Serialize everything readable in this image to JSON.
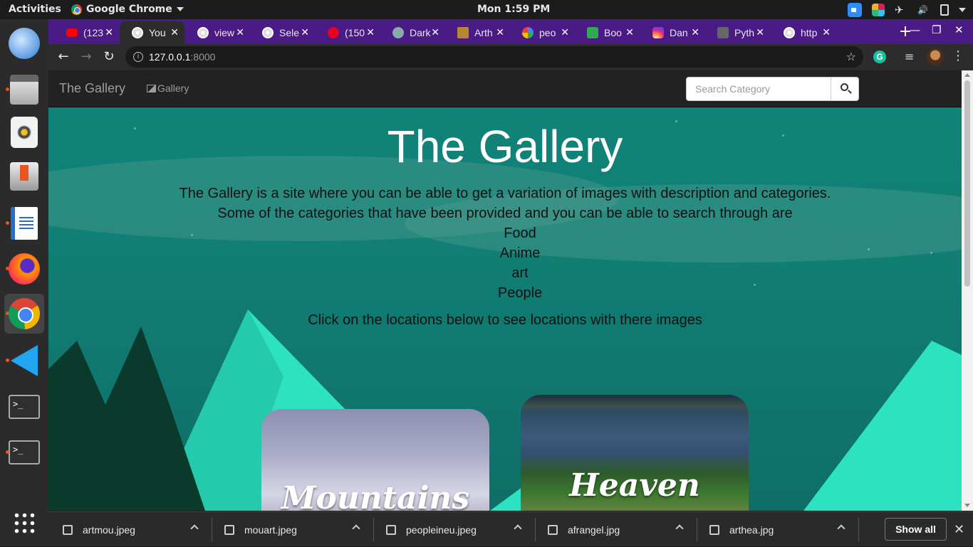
{
  "topbar": {
    "activities": "Activities",
    "app_name": "Google Chrome",
    "clock": "Mon  1:59 PM"
  },
  "dock": {
    "items": [
      "thunderbird-icon",
      "files-icon",
      "rhythmbox-icon",
      "software-updater-icon",
      "libreoffice-writer-icon",
      "firefox-icon",
      "chrome-icon",
      "vscode-icon",
      "terminal-icon",
      "terminal-icon",
      "app-grid-icon"
    ]
  },
  "tabs": [
    {
      "label": "(123",
      "icon": "youtube-icon"
    },
    {
      "label": "You",
      "icon": "globe-icon",
      "active": true
    },
    {
      "label": "view",
      "icon": "globe-icon"
    },
    {
      "label": "Sele",
      "icon": "globe-icon"
    },
    {
      "label": "(150",
      "icon": "pinterest-icon"
    },
    {
      "label": "Dark",
      "icon": "dark-icon"
    },
    {
      "label": "Arth",
      "icon": "book-icon"
    },
    {
      "label": "peo",
      "icon": "google-icon"
    },
    {
      "label": "Boo",
      "icon": "boo-icon"
    },
    {
      "label": "Dan",
      "icon": "instagram-icon"
    },
    {
      "label": "Pyth",
      "icon": "python-icon"
    },
    {
      "label": "http",
      "icon": "globe-icon"
    }
  ],
  "omnibox": {
    "host": "127.0.0.1",
    "port": ":8000"
  },
  "site": {
    "brand": "The Gallery",
    "nav_gallery": "Gallery",
    "search_placeholder": "Search Category",
    "hero_title": "The Gallery",
    "intro_1": "The Gallery is a site where you can be able to get a variation of images with description and categories.",
    "intro_2": "Some of the categories that have been provided and you can be able to search through are",
    "categories": [
      "Food",
      "Anime",
      "art",
      "People"
    ],
    "locations_prompt": "Click on the locations below to see locations with there images",
    "cards": [
      {
        "title": "Mountains"
      },
      {
        "title": "Heaven"
      }
    ]
  },
  "downloads": {
    "files": [
      "artmou.jpeg",
      "mouart.jpeg",
      "peopleineu.jpeg",
      "afrangel.jpg",
      "arthea.jpg"
    ],
    "show_all": "Show all"
  },
  "colors": {
    "tab_strip": "#4b1b85",
    "page_teal": "#10847a",
    "navbar": "#222222"
  }
}
